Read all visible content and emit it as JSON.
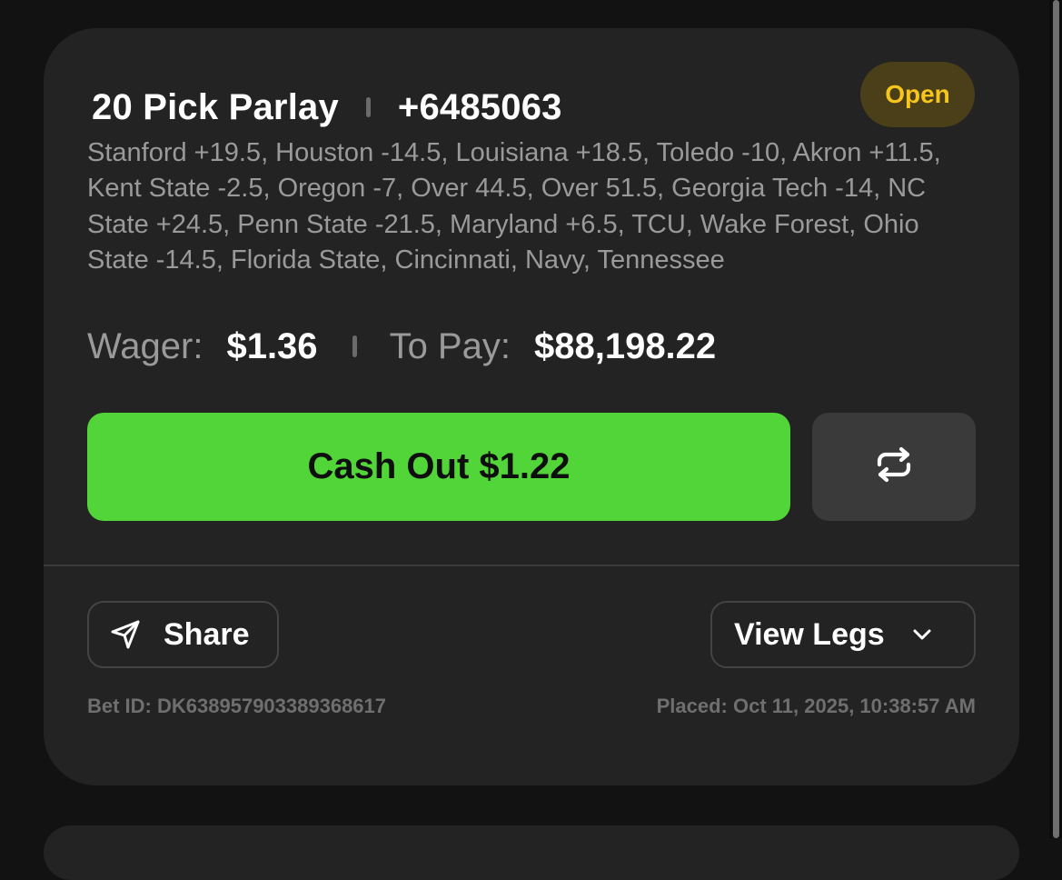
{
  "bet": {
    "title": "20 Pick Parlay",
    "odds": "+6485063",
    "status": "Open",
    "legs_summary": "Stanford +19.5, Houston -14.5, Louisiana +18.5, Toledo -10, Akron +11.5, Kent State -2.5, Oregon -7, Over 44.5, Over 51.5, Georgia Tech -14, NC State +24.5, Penn State -21.5, Maryland +6.5, TCU, Wake Forest, Ohio State -14.5, Florida State, Cincinnati, Navy, Tennessee",
    "wager_label": "Wager:",
    "wager_value": "$1.36",
    "topay_label": "To Pay:",
    "topay_value": "$88,198.22",
    "cashout_label": "Cash Out $1.22",
    "swap_icon": "swap-arrows-icon",
    "share_label": "Share",
    "share_icon": "send-icon",
    "view_legs_label": "View Legs",
    "view_legs_icon": "chevron-down-icon",
    "bet_id": "Bet ID: DK638957903389368617",
    "placed": "Placed: Oct 11, 2025, 10:38:57 AM"
  },
  "colors": {
    "background": "#121212",
    "card": "#232323",
    "cashout_green": "#52d538",
    "open_text": "#f6c61d",
    "open_bg": "#4a3f18",
    "muted_text": "#9a9a9a"
  }
}
